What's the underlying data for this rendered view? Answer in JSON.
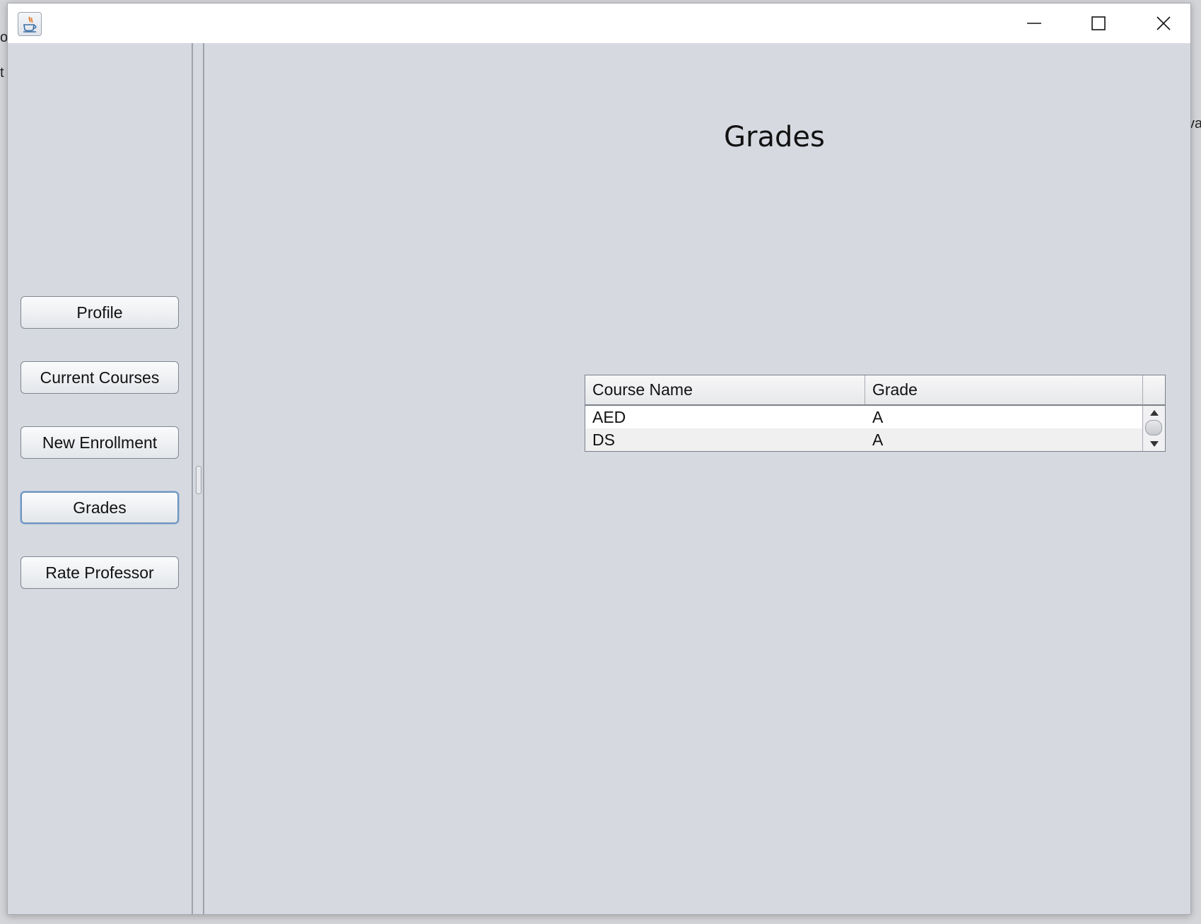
{
  "window": {
    "app_icon": "java-icon"
  },
  "controls": {
    "minimize_icon": "minimize-icon",
    "maximize_icon": "maximize-icon",
    "close_icon": "close-icon"
  },
  "sidebar": {
    "items": [
      {
        "label": "Profile"
      },
      {
        "label": "Current Courses"
      },
      {
        "label": "New Enrollment"
      },
      {
        "label": "Grades",
        "focused": true
      },
      {
        "label": "Rate Professor"
      }
    ]
  },
  "main": {
    "title": "Grades",
    "table": {
      "columns": [
        "Course Name",
        "Grade"
      ],
      "rows": [
        [
          "AED",
          "A"
        ],
        [
          "DS",
          "A"
        ]
      ]
    }
  },
  "background": {
    "fragments": [
      "or",
      "t c",
      "va"
    ]
  },
  "colors": {
    "window_bg": "#d6d9e0",
    "focus_ring": "#6e93bf"
  }
}
